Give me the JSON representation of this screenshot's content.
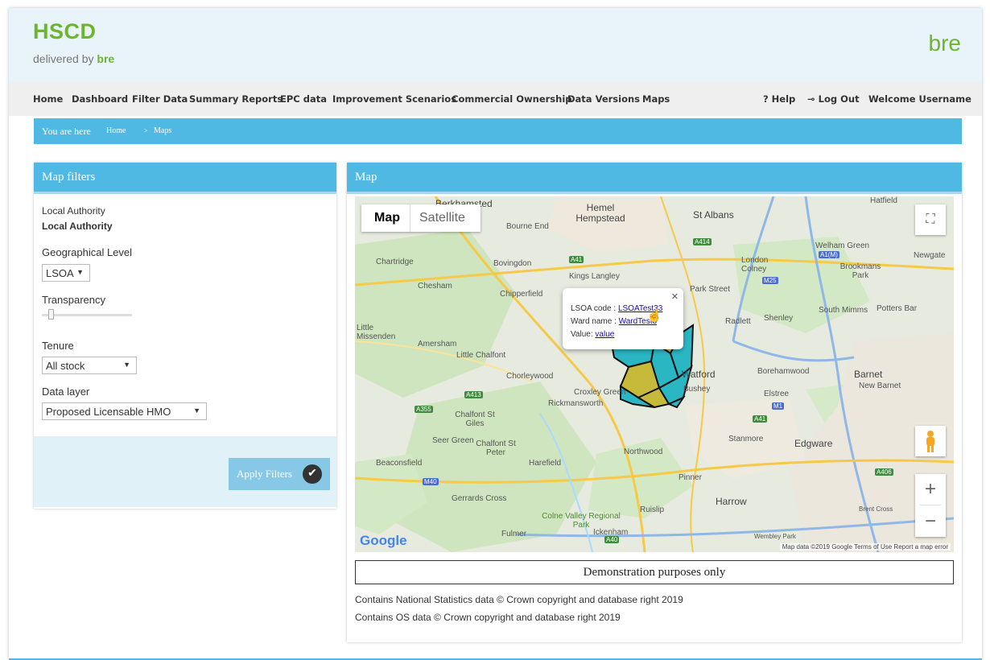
{
  "header": {
    "logo_title": "HSCD",
    "logo_sub_prefix": "delivered by",
    "logo_sub_brand": "bre",
    "brand_right": "bre"
  },
  "nav": {
    "items": [
      "Home",
      "Dashboard",
      "Filter Data",
      "Summary Reports",
      "EPC data",
      "Improvement Scenarios",
      "Commercial Ownership",
      "Data Versions",
      "Maps"
    ],
    "help": "? Help",
    "logout": "Log Out",
    "welcome": "Welcome Username"
  },
  "breadcrumb": {
    "prefix": "You are here",
    "home": "Home",
    "separator": ">",
    "current": "Maps"
  },
  "filters": {
    "title": "Map filters",
    "local_authority_label": "Local Authority",
    "local_authority_value": "Local Authority",
    "geo_label": "Geographical Level",
    "geo_value": "LSOA",
    "transparency_label": "Transparency",
    "transparency_level": 0.1,
    "tenure_label": "Tenure",
    "tenure_value": "All stock",
    "data_layer_label": "Data layer",
    "data_layer_value": "Proposed Licensable HMO",
    "apply_label": "Apply Filters"
  },
  "map": {
    "title": "Map",
    "type_map": "Map",
    "type_satellite": "Satellite",
    "popup": {
      "lsoa_label": "LSOA code :",
      "lsoa_value": "LSOATest33",
      "ward_label": "Ward name :",
      "ward_value": "WardTest8",
      "value_label": "Value:",
      "value_value": "value"
    },
    "places": [
      "Berkhamsted",
      "Hemel Hempstead",
      "St Albans",
      "Hatfield",
      "Bourne End",
      "Chartridge",
      "Bovingdon",
      "London Colney",
      "Welham Green",
      "Newgate",
      "Kings Langley",
      "Brookmans Park",
      "Chesham",
      "Chipperfield",
      "Park Street",
      "South Mimms",
      "Potters Bar",
      "Radlett",
      "Shenley",
      "Little Missenden",
      "Amersham",
      "Little Chalfont",
      "Chorleywood",
      "Watford",
      "Borehamwood",
      "Barnet",
      "New Barnet",
      "Croxley Green",
      "Bushey",
      "Elstree",
      "Rickmansworth",
      "Chalfont St Giles",
      "Seer Green",
      "Chalfont St Peter",
      "Northwood",
      "Stanmore",
      "Edgware",
      "Beaconsfield",
      "Harefield",
      "Pinner",
      "Gerrards Cross",
      "Harrow",
      "Ruislip",
      "Colne Valley Regional Park",
      "Ickenham",
      "Fulmer",
      "Brent Cross",
      "Wembley Park"
    ],
    "roads": [
      "A41",
      "A414",
      "A1(M)",
      "M25",
      "A413",
      "A355",
      "M1",
      "A41",
      "M40",
      "A406",
      "A40"
    ],
    "google_logo": "Google",
    "footer": "Map data ©2019 Google   Terms of Use   Report a map error",
    "zoom_in": "+",
    "zoom_out": "−",
    "fullscreen": "⛶"
  },
  "notices": {
    "demo": "Demonstration purposes only",
    "copyright1": "Contains National Statistics data © Crown copyright and database right 2019",
    "copyright2": "Contains OS data © Crown copyright and database right 2019"
  },
  "colors": {
    "accent": "#4fb9e3",
    "brand_green": "#6cb52d",
    "lsoa_fill_teal": "#2bb6c4",
    "lsoa_fill_olive": "#c7b93a"
  }
}
